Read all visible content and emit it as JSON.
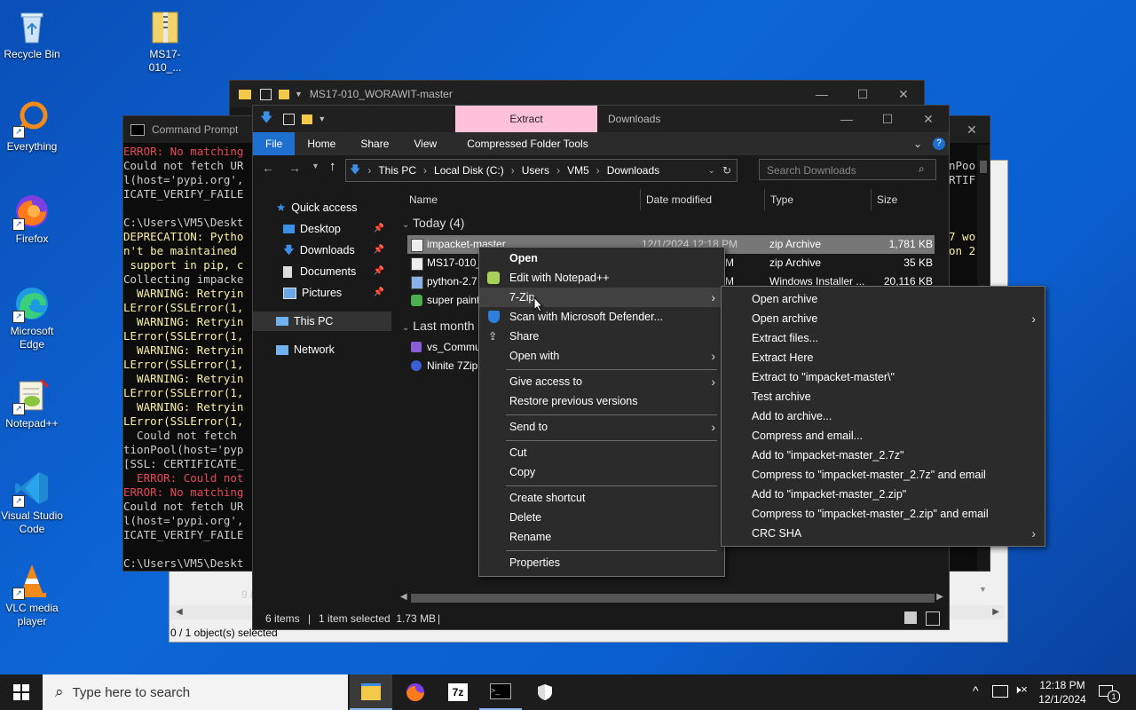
{
  "desktop": {
    "icons": [
      {
        "label": "Recycle Bin"
      },
      {
        "label": "MS17-010_..."
      },
      {
        "label": "Everything"
      },
      {
        "label": "Firefox"
      },
      {
        "label": "Microsoft Edge"
      },
      {
        "label": "Notepad++"
      },
      {
        "label": "Visual Studio Code"
      },
      {
        "label": "VLC media player"
      }
    ]
  },
  "win_back": {
    "title": "MS17-010_WORAWIT-master",
    "status_left": "9 i",
    "status_bottom": "0 / 1 object(s) selected"
  },
  "cmd": {
    "title": "Command Prompt",
    "lines": [
      {
        "text": "ERROR: No matching",
        "color": "red"
      },
      {
        "text": "Could not fetch UR",
        "color": "normal"
      },
      {
        "text": "l(host='pypi.org',",
        "color": "normal"
      },
      {
        "text": "ICATE_VERIFY_FAILE",
        "color": "normal"
      },
      {
        "text": "",
        "color": "normal"
      },
      {
        "text": "C:\\Users\\VM5\\Deskt",
        "color": "normal"
      },
      {
        "text": "DEPRECATION: Pytho",
        "color": "yel"
      },
      {
        "text": "n't be maintained ",
        "color": "yel"
      },
      {
        "text": " support in pip, c",
        "color": "yel"
      },
      {
        "text": "Collecting impacke",
        "color": "normal"
      },
      {
        "text": "  WARNING: Retryin",
        "color": "yel"
      },
      {
        "text": "LError(SSLError(1,",
        "color": "yel"
      },
      {
        "text": "  WARNING: Retryin",
        "color": "yel"
      },
      {
        "text": "LError(SSLError(1,",
        "color": "yel"
      },
      {
        "text": "  WARNING: Retryin",
        "color": "yel"
      },
      {
        "text": "LError(SSLError(1,",
        "color": "yel"
      },
      {
        "text": "  WARNING: Retryin",
        "color": "yel"
      },
      {
        "text": "LError(SSLError(1,",
        "color": "yel"
      },
      {
        "text": "  WARNING: Retryin",
        "color": "yel"
      },
      {
        "text": "LError(SSLError(1,",
        "color": "yel"
      },
      {
        "text": "  Could not fetch ",
        "color": "normal"
      },
      {
        "text": "tionPool(host='pyp",
        "color": "normal"
      },
      {
        "text": "[SSL: CERTIFICATE_",
        "color": "normal"
      },
      {
        "text": "  ERROR: Could not",
        "color": "red"
      },
      {
        "text": "ERROR: No matching",
        "color": "red"
      },
      {
        "text": "Could not fetch UR",
        "color": "normal"
      },
      {
        "text": "l(host='pypi.org',",
        "color": "normal"
      },
      {
        "text": "ICATE_VERIFY_FAILE",
        "color": "normal"
      },
      {
        "text": "",
        "color": "normal"
      },
      {
        "text": "C:\\Users\\VM5\\Deskt",
        "color": "normal"
      }
    ],
    "right_lines": [
      {
        "text": "nPoo",
        "color": "normal"
      },
      {
        "text": "RTIF",
        "color": "normal"
      },
      {
        "text": "7 wo",
        "color": "yel"
      },
      {
        "text": "on 2",
        "color": "yel"
      }
    ]
  },
  "explorer": {
    "title": "Downloads",
    "contextual_tab": "Extract",
    "tabs": [
      "File",
      "Home",
      "Share",
      "View",
      "Compressed Folder Tools"
    ],
    "breadcrumb": [
      "This PC",
      "Local Disk (C:)",
      "Users",
      "VM5",
      "Downloads"
    ],
    "search_placeholder": "Search Downloads",
    "nav": [
      {
        "label": "Quick access",
        "pinned": false
      },
      {
        "label": "Desktop",
        "pinned": true
      },
      {
        "label": "Downloads",
        "pinned": true
      },
      {
        "label": "Documents",
        "pinned": true
      },
      {
        "label": "Pictures",
        "pinned": true
      },
      {
        "label": "This PC",
        "pinned": false
      },
      {
        "label": "Network",
        "pinned": false
      }
    ],
    "columns": [
      "Name",
      "Date modified",
      "Type",
      "Size"
    ],
    "groups": {
      "today": "Today (4)",
      "last_month": "Last month"
    },
    "files_today": [
      {
        "name": "impacket-master",
        "date": "12/1/2024 12:18 PM",
        "type": "zip Archive",
        "size": "1,781 KB"
      },
      {
        "name": "MS17-010_",
        "date": "M",
        "type": "zip Archive",
        "size": "35 KB"
      },
      {
        "name": "python-2.7",
        "date": "M",
        "type": "Windows Installer ...",
        "size": "20,116 KB"
      },
      {
        "name": "super paint",
        "date": "",
        "type": "",
        "size": ""
      }
    ],
    "files_last_month": [
      {
        "name": "vs_Commu"
      },
      {
        "name": "Ninite 7Zip"
      }
    ],
    "status": {
      "items": "6 items",
      "selected": "1 item selected  1.73 MB"
    }
  },
  "context_menu": {
    "items": [
      "Open",
      "Edit with Notepad++",
      "7-Zip",
      "Scan with Microsoft Defender...",
      "Share",
      "Open with",
      "Give access to",
      "Restore previous versions",
      "Send to",
      "Cut",
      "Copy",
      "Create shortcut",
      "Delete",
      "Rename",
      "Properties"
    ]
  },
  "submenu_7zip": {
    "items": [
      "Open archive",
      "Open archive",
      "Extract files...",
      "Extract Here",
      "Extract to \"impacket-master\\\"",
      "Test archive",
      "Add to archive...",
      "Compress and email...",
      "Add to \"impacket-master_2.7z\"",
      "Compress to \"impacket-master_2.7z\" and email",
      "Add to \"impacket-master_2.zip\"",
      "Compress to \"impacket-master_2.zip\" and email",
      "CRC SHA"
    ]
  },
  "taskbar": {
    "search_placeholder": "Type here to search",
    "time": "12:18 PM",
    "date": "12/1/2024",
    "notification_count": "1"
  }
}
